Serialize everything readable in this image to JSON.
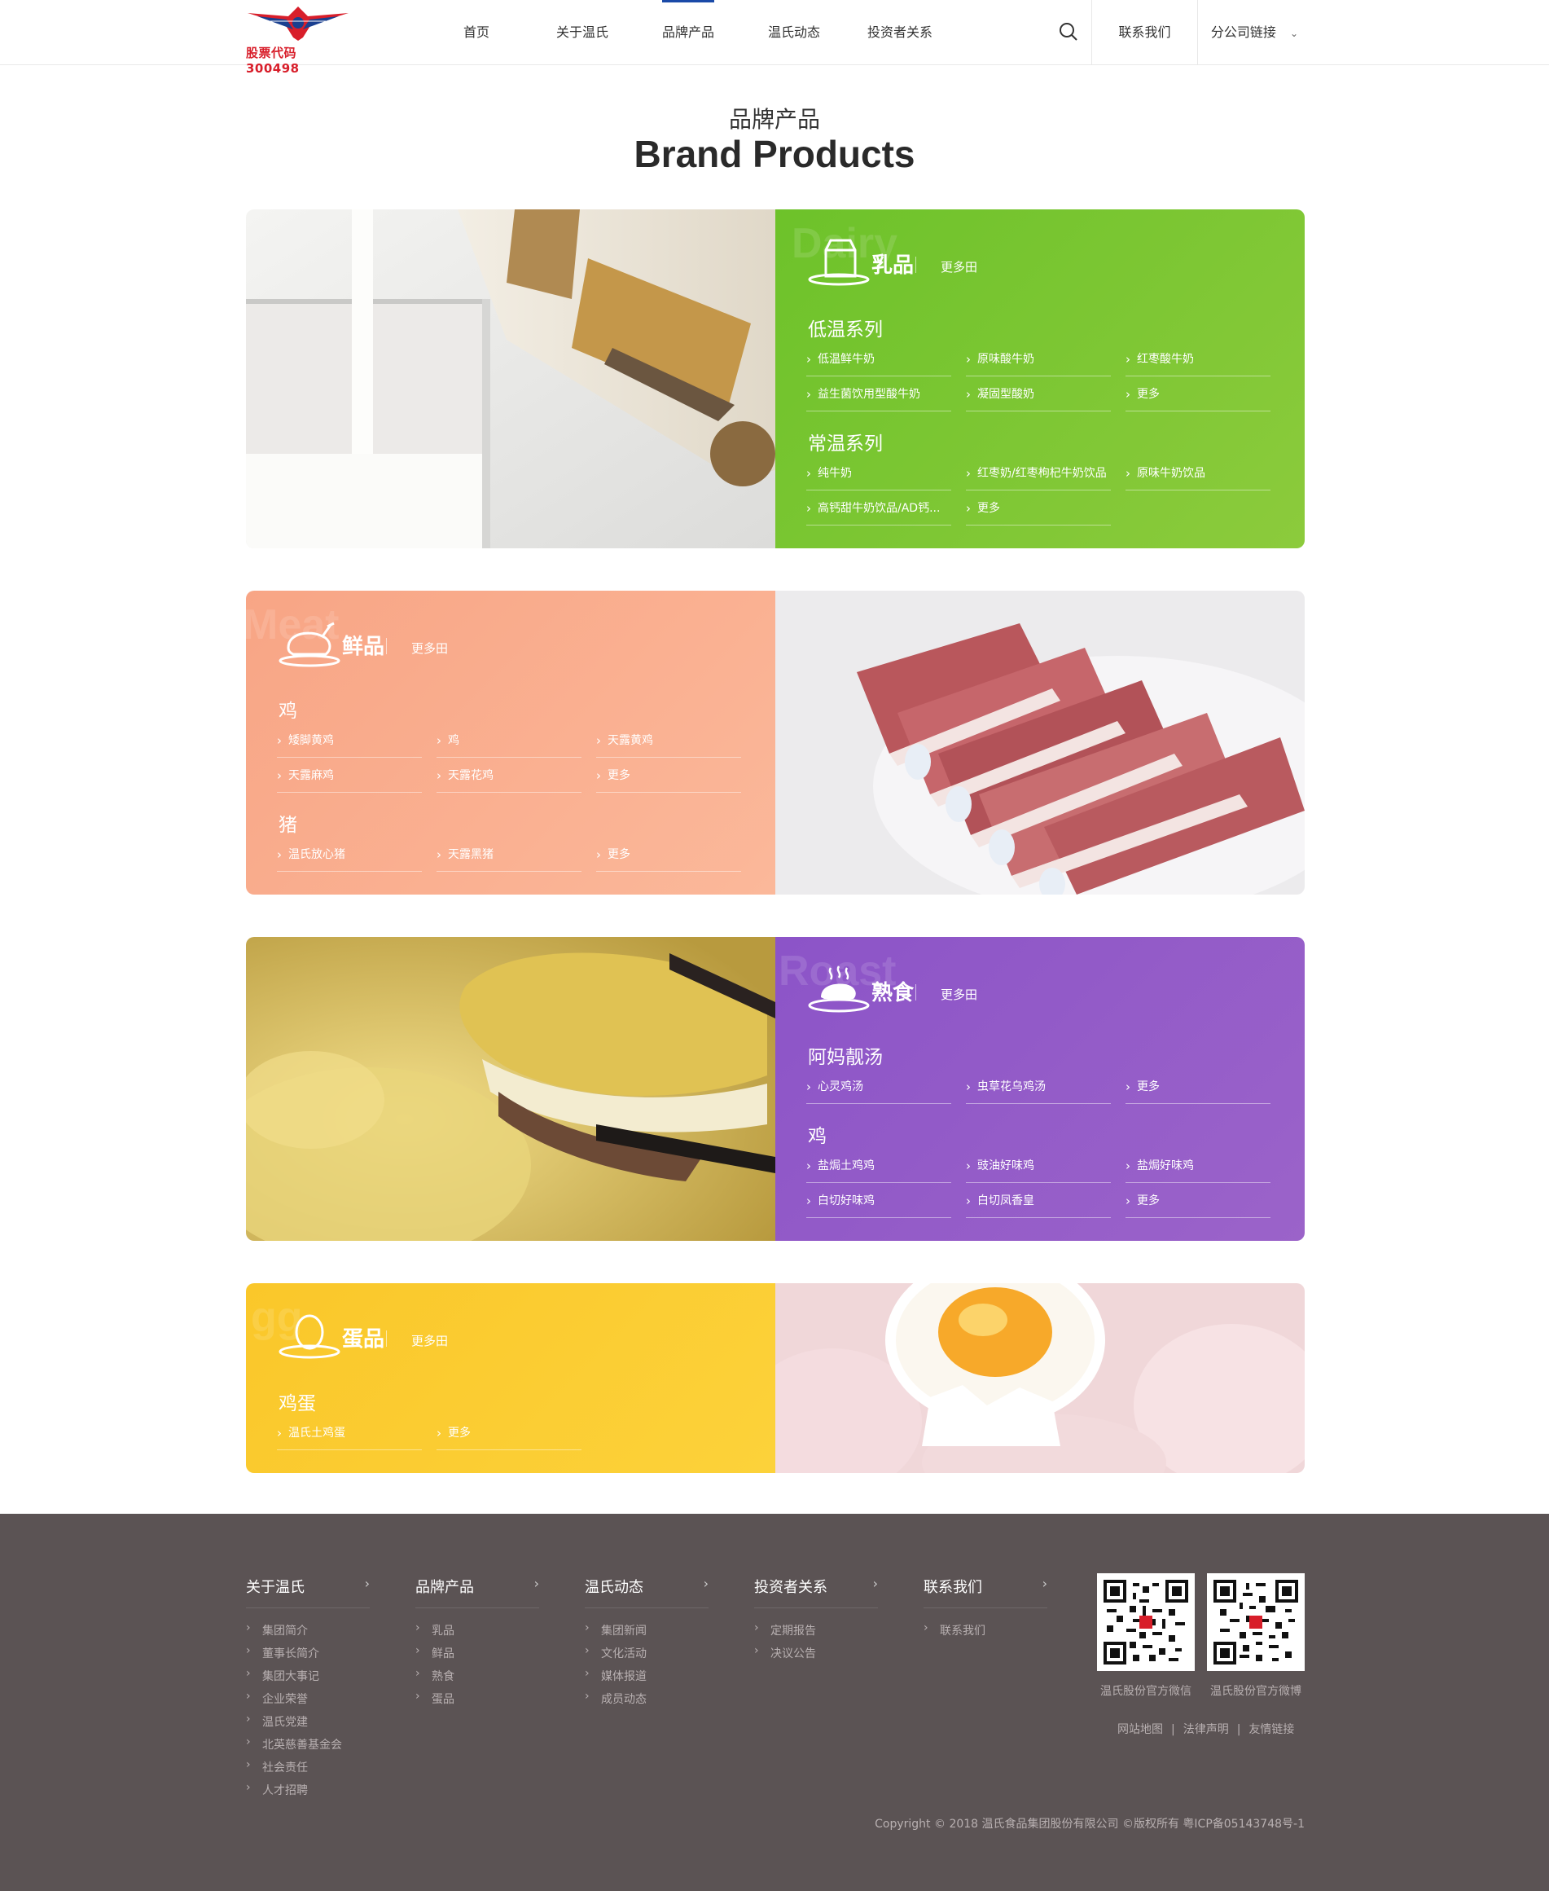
{
  "header": {
    "logo_text": "股票代码 300498",
    "nav": [
      "首页",
      "关于温氏",
      "品牌产品",
      "温氏动态",
      "投资者关系"
    ],
    "active_nav": "品牌产品",
    "contact": "联系我们",
    "branch": "分公司链接"
  },
  "section": {
    "title_cn": "品牌产品",
    "title_en": "Brand Products"
  },
  "products": {
    "dairy": {
      "name": "乳品",
      "ghost": "Dairy",
      "more": "更多田",
      "color": "#74c52c",
      "groups": [
        {
          "title": "低温系列",
          "items": [
            "低温鲜牛奶",
            "原味酸牛奶",
            "红枣酸牛奶",
            "益生菌饮用型酸牛奶",
            "凝固型酸奶",
            "更多"
          ]
        },
        {
          "title": "常温系列",
          "items": [
            "纯牛奶",
            "红枣奶/红枣枸杞牛奶饮品",
            "原味牛奶饮品",
            "高钙甜牛奶饮品/AD钙...",
            "更多"
          ]
        }
      ]
    },
    "fresh": {
      "name": "鲜品",
      "ghost": "Meat",
      "more": "更多田",
      "color": "#f9ad8d",
      "groups": [
        {
          "title": "鸡",
          "items": [
            "矮脚黄鸡",
            "鸡",
            "天露黄鸡",
            "天露麻鸡",
            "天露花鸡",
            "更多"
          ]
        },
        {
          "title": "猪",
          "items": [
            "温氏放心猪",
            "天露黑猪",
            "更多"
          ]
        }
      ]
    },
    "cooked": {
      "name": "熟食",
      "ghost": "Roast",
      "more": "更多田",
      "color": "#8b55c6",
      "groups": [
        {
          "title": "阿妈靓汤",
          "items": [
            "心灵鸡汤",
            "虫草花乌鸡汤",
            "更多"
          ]
        },
        {
          "title": "鸡",
          "items": [
            "盐焗土鸡鸡",
            "豉油好味鸡",
            "盐焗好味鸡",
            "白切好味鸡",
            "白切凤香皇",
            "更多"
          ]
        }
      ]
    },
    "egg": {
      "name": "蛋品",
      "ghost": "gg",
      "more": "更多田",
      "color": "#fbcb2c",
      "groups": [
        {
          "title": "鸡蛋",
          "items": [
            "温氏土鸡蛋",
            "更多"
          ]
        }
      ]
    }
  },
  "footer": {
    "columns": [
      {
        "title": "关于温氏",
        "items": [
          "集团简介",
          "董事长简介",
          "集团大事记",
          "企业荣誉",
          "温氏党建",
          "北英慈善基金会",
          "社会责任",
          "人才招聘"
        ]
      },
      {
        "title": "品牌产品",
        "items": [
          "乳品",
          "鲜品",
          "熟食",
          "蛋品"
        ]
      },
      {
        "title": "温氏动态",
        "items": [
          "集团新闻",
          "文化活动",
          "媒体报道",
          "成员动态"
        ]
      },
      {
        "title": "投资者关系",
        "items": [
          "定期报告",
          "决议公告"
        ]
      },
      {
        "title": "联系我们",
        "items": [
          "联系我们"
        ]
      }
    ],
    "qr_wechat": "温氏股份官方微信",
    "qr_weibo": "温氏股份官方微博",
    "links": [
      "网站地图",
      "法律声明",
      "友情链接"
    ],
    "copyright": "Copyright © 2018 温氏食品集团股份有限公司 ©版权所有 粤ICP备05143748号-1"
  }
}
